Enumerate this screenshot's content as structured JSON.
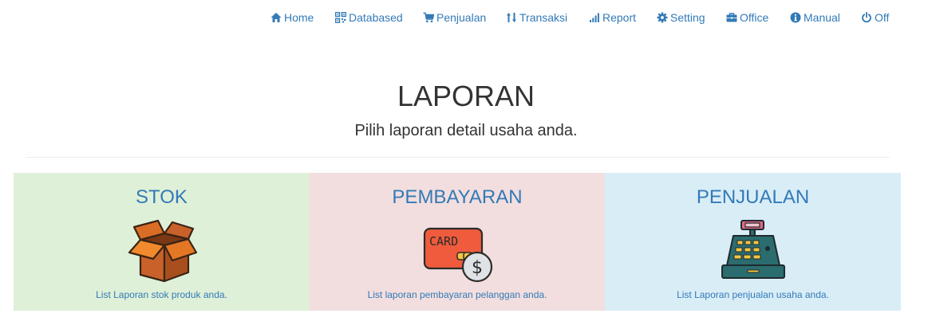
{
  "nav": {
    "items": [
      {
        "label": "Home",
        "icon": "home-icon"
      },
      {
        "label": "Databased",
        "icon": "qrcode-icon"
      },
      {
        "label": "Penjualan",
        "icon": "shopping-cart-icon"
      },
      {
        "label": "Transaksi",
        "icon": "sort-arrows-icon"
      },
      {
        "label": "Report",
        "icon": "signal-bars-icon"
      },
      {
        "label": "Setting",
        "icon": "gear-icon"
      },
      {
        "label": "Office",
        "icon": "briefcase-icon"
      },
      {
        "label": "Manual",
        "icon": "info-icon"
      },
      {
        "label": "Off",
        "icon": "power-icon"
      }
    ]
  },
  "header": {
    "title": "LAPORAN",
    "subtitle": "Pilih laporan detail usaha anda."
  },
  "panels": [
    {
      "title": "STOK",
      "caption": "List Laporan stok produk anda.",
      "icon": "box-icon",
      "bg": "#dff0d8"
    },
    {
      "title": "PEMBAYARAN",
      "caption": "List laporan pembayaran pelanggan anda.",
      "icon": "card-payment-icon",
      "card_text": "CARD",
      "coin_text": "$",
      "bg": "#f2dede"
    },
    {
      "title": "PENJUALAN",
      "caption": "List Laporan penjualan usaha anda.",
      "icon": "cash-register-icon",
      "bg": "#d9edf7"
    }
  ],
  "colors": {
    "link": "#337ab7",
    "text": "#333333"
  }
}
